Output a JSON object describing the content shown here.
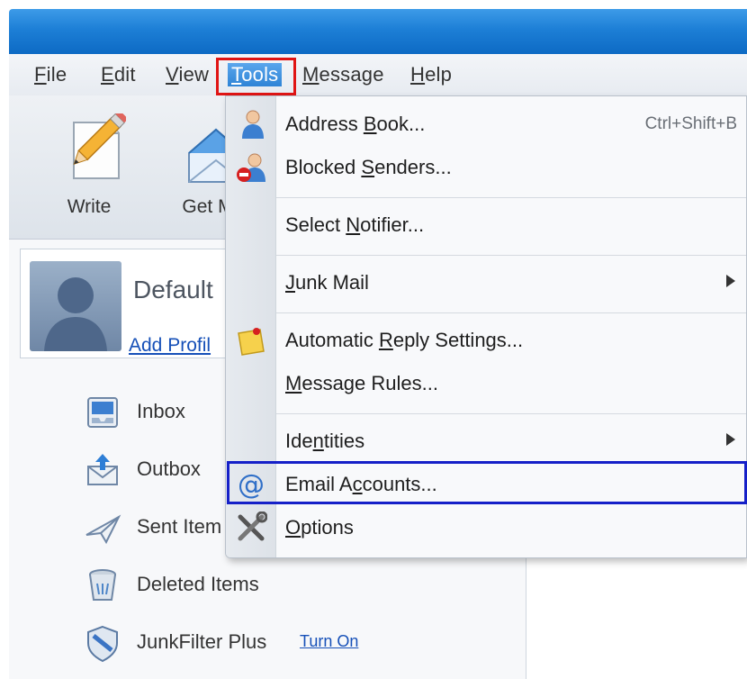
{
  "menubar": {
    "items": [
      {
        "pre": "",
        "u": "F",
        "post": "ile"
      },
      {
        "pre": "",
        "u": "E",
        "post": "dit"
      },
      {
        "pre": "",
        "u": "V",
        "post": "iew"
      },
      {
        "pre": "",
        "u": "T",
        "post": "ools"
      },
      {
        "pre": "",
        "u": "M",
        "post": "essage"
      },
      {
        "pre": "",
        "u": "H",
        "post": "elp"
      }
    ]
  },
  "toolbar": {
    "write_label": "Write",
    "get_mail_label": "Get M"
  },
  "profile": {
    "name": "Default",
    "add_link": "Add Profil"
  },
  "folders": {
    "inbox": "Inbox",
    "outbox": "Outbox",
    "sent": "Sent Item",
    "deleted": "Deleted Items",
    "junkfilter": "JunkFilter Plus",
    "turn_on": "Turn On"
  },
  "tools_menu": {
    "address_book": {
      "pre": "Address ",
      "u": "B",
      "post": "ook...",
      "shortcut": "Ctrl+Shift+B"
    },
    "blocked_senders": {
      "pre": "Blocked ",
      "u": "S",
      "post": "enders..."
    },
    "select_notifier": {
      "pre": "Select ",
      "u": "N",
      "post": "otifier..."
    },
    "junk_mail": {
      "pre": "",
      "u": "J",
      "post": "unk Mail"
    },
    "auto_reply": {
      "pre": "Automatic ",
      "u": "R",
      "post": "eply Settings..."
    },
    "message_rules": {
      "pre": "",
      "u": "M",
      "post": "essage Rules..."
    },
    "identities": {
      "pre": "Ide",
      "u": "n",
      "post": "tities"
    },
    "email_accounts": {
      "pre": "Email A",
      "u": "c",
      "post": "counts..."
    },
    "options": {
      "pre": "",
      "u": "O",
      "post": "ptions"
    }
  },
  "colors": {
    "highlight_tools": "#e01414",
    "highlight_email_accounts": "#1520c8",
    "titlebar": "#1d7fd6"
  }
}
